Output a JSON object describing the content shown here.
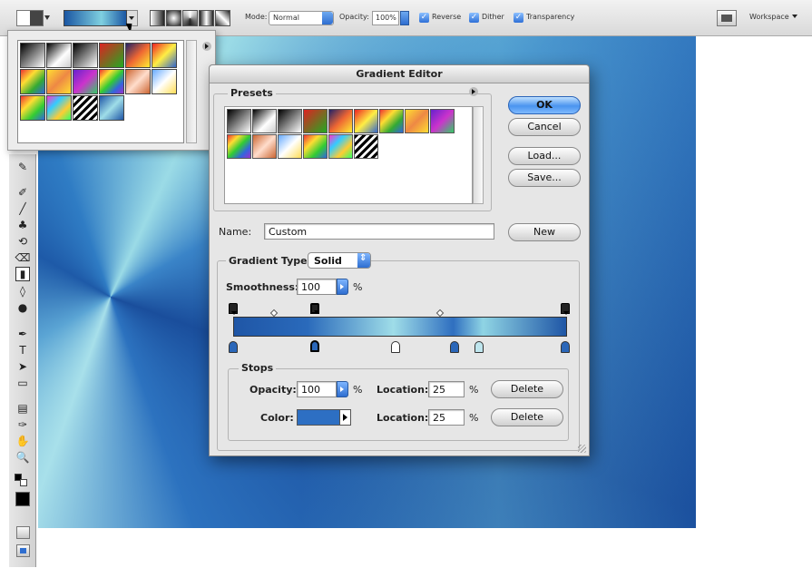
{
  "optionsbar": {
    "mode_label": "Mode:",
    "mode_value": "Normal",
    "opacity_label": "Opacity:",
    "opacity_value": "100%",
    "reverse_label": "Reverse",
    "dither_label": "Dither",
    "transparency_label": "Transparency",
    "workspace_label": "Workspace"
  },
  "editor": {
    "title": "Gradient Editor",
    "presets_label": "Presets",
    "ok_label": "OK",
    "cancel_label": "Cancel",
    "load_label": "Load...",
    "save_label": "Save...",
    "name_label": "Name:",
    "name_value": "Custom",
    "new_label": "New",
    "gradient_type_label": "Gradient Type:",
    "gradient_type_value": "Solid",
    "smoothness_label": "Smoothness:",
    "smoothness_value": "100",
    "percent": "%",
    "stops_label": "Stops",
    "opacity_label": "Opacity:",
    "opacity_value": "100",
    "color_label": "Color:",
    "location_label": "Location:",
    "opacity_location_value": "25",
    "color_location_value": "25",
    "delete_label": "Delete",
    "selected_color": "#2d6fc3"
  },
  "colors": {
    "accent": "#2f6ed0",
    "canvas_dark": "#1e5aa8",
    "canvas_light": "#9bdbe6"
  }
}
